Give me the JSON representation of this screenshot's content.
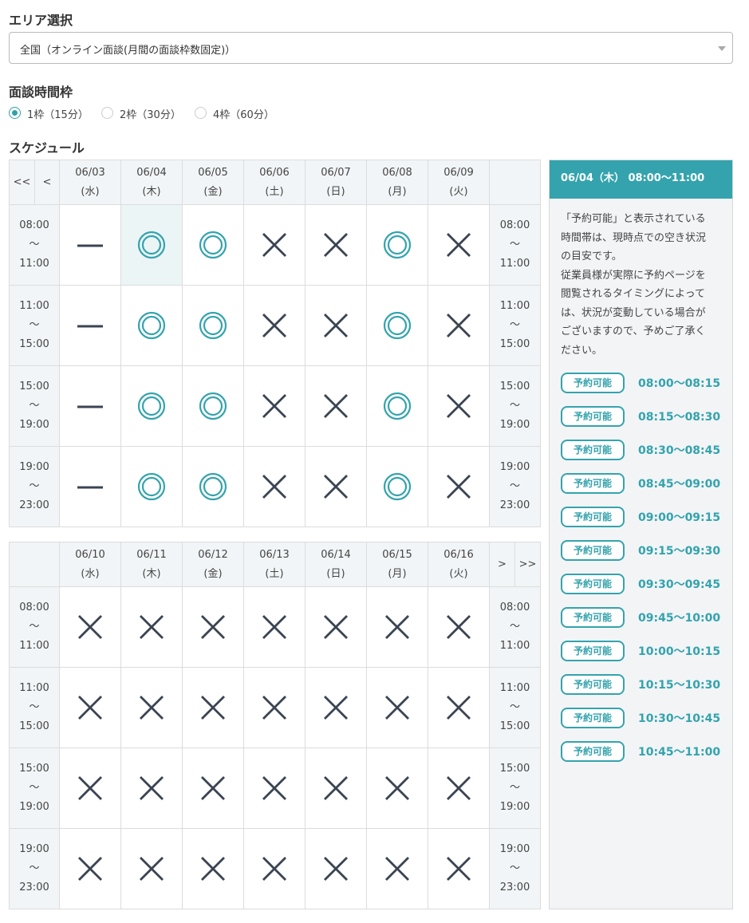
{
  "area": {
    "title": "エリア選択",
    "selected": "全国（オンライン面談(月間の面談枠数固定)）"
  },
  "duration": {
    "title": "面談時間枠",
    "options": [
      {
        "label": "1枠（15分）",
        "checked": true
      },
      {
        "label": "2枠（30分）",
        "checked": false
      },
      {
        "label": "4枠（60分）",
        "checked": false
      }
    ]
  },
  "schedule": {
    "title": "スケジュール",
    "nav": {
      "first": "<<",
      "prev": "<",
      "next": ">",
      "last": ">>"
    },
    "time_slots": [
      {
        "start": "08:00",
        "sep": "～",
        "end": "11:00"
      },
      {
        "start": "11:00",
        "sep": "～",
        "end": "15:00"
      },
      {
        "start": "15:00",
        "sep": "～",
        "end": "19:00"
      },
      {
        "start": "19:00",
        "sep": "～",
        "end": "23:00"
      }
    ],
    "weeks": [
      {
        "days": [
          {
            "date": "06/03",
            "dow": "(水)"
          },
          {
            "date": "06/04",
            "dow": "(木)"
          },
          {
            "date": "06/05",
            "dow": "(金)"
          },
          {
            "date": "06/06",
            "dow": "(土)"
          },
          {
            "date": "06/07",
            "dow": "(日)"
          },
          {
            "date": "06/08",
            "dow": "(月)"
          },
          {
            "date": "06/09",
            "dow": "(火)"
          }
        ],
        "status": [
          [
            "dash",
            "available",
            "available",
            "full",
            "full",
            "available",
            "full"
          ],
          [
            "dash",
            "available",
            "available",
            "full",
            "full",
            "available",
            "full"
          ],
          [
            "dash",
            "available",
            "available",
            "full",
            "full",
            "available",
            "full"
          ],
          [
            "dash",
            "available",
            "available",
            "full",
            "full",
            "available",
            "full"
          ]
        ]
      },
      {
        "days": [
          {
            "date": "06/10",
            "dow": "(水)"
          },
          {
            "date": "06/11",
            "dow": "(木)"
          },
          {
            "date": "06/12",
            "dow": "(金)"
          },
          {
            "date": "06/13",
            "dow": "(土)"
          },
          {
            "date": "06/14",
            "dow": "(日)"
          },
          {
            "date": "06/15",
            "dow": "(月)"
          },
          {
            "date": "06/16",
            "dow": "(火)"
          }
        ],
        "status": [
          [
            "full",
            "full",
            "full",
            "full",
            "full",
            "full",
            "full"
          ],
          [
            "full",
            "full",
            "full",
            "full",
            "full",
            "full",
            "full"
          ],
          [
            "full",
            "full",
            "full",
            "full",
            "full",
            "full",
            "full"
          ],
          [
            "full",
            "full",
            "full",
            "full",
            "full",
            "full",
            "full"
          ]
        ]
      }
    ],
    "selected_cell": {
      "week": 0,
      "row": 0,
      "col": 1
    }
  },
  "detail": {
    "header": "06/04（木） 08:00～11:00",
    "note_lines": [
      "「予約可能」と表示されている",
      "時間帯は、現時点での空き状況",
      "の目安です。",
      "従業員様が実際に予約ページを",
      "閲覧されるタイミングによって",
      "は、状況が変動している場合が",
      "ございますので、予めご了承く",
      "ださい。"
    ],
    "button_label": "予約可能",
    "slots": [
      "08:00～08:15",
      "08:15～08:30",
      "08:30～08:45",
      "08:45～09:00",
      "09:00～09:15",
      "09:15～09:30",
      "09:30～09:45",
      "09:45～10:00",
      "10:00～10:15",
      "10:15～10:30",
      "10:30～10:45",
      "10:45～11:00"
    ]
  },
  "colors": {
    "accent": "#34a3ad",
    "mark_dark": "#3a4452",
    "header_bg": "#f2f5f7",
    "selected_bg": "#ebf5f6"
  },
  "icons": {
    "available": "double-circle-icon",
    "full": "cross-icon",
    "dash": "dash-icon",
    "caret": "chevron-down-icon"
  }
}
